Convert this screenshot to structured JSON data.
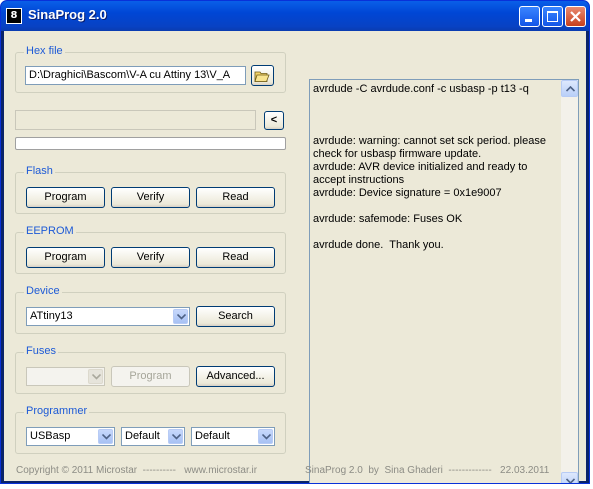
{
  "window": {
    "title": "SinaProg 2.0",
    "title_icon_glyph": "8"
  },
  "hex": {
    "legend": "Hex file",
    "path": "D:\\Draghici\\Bascom\\V-A cu Attiny 13\\V_A"
  },
  "flash": {
    "legend": "Flash",
    "program": "Program",
    "verify": "Verify",
    "read": "Read"
  },
  "eeprom": {
    "legend": "EEPROM",
    "program": "Program",
    "verify": "Verify",
    "read": "Read"
  },
  "device": {
    "legend": "Device",
    "selected": "ATtiny13",
    "search": "Search"
  },
  "fuses": {
    "legend": "Fuses",
    "selected": "",
    "program": "Program",
    "advanced": "Advanced..."
  },
  "programmer": {
    "legend": "Programmer",
    "type": "USBasp",
    "speed1": "Default",
    "speed2": "Default"
  },
  "collapse_button": "<",
  "output": {
    "text": "avrdude -C avrdude.conf -c usbasp -p t13 -q\n\n\n\navrdude: warning: cannot set sck period. please check for usbasp firmware update.\navrdude: AVR device initialized and ready to accept instructions\navrdude: Device signature = 0x1e9007\n\navrdude: safemode: Fuses OK\n\navrdude done.  Thank you."
  },
  "footer": {
    "left": "Copyright © 2011 Microstar  ----------   www.microstar.ir",
    "right": "SinaProg 2.0  by  Sina Ghaderi  -------------   22.03.2011"
  },
  "colors": {
    "title_bar": "#0046d5",
    "legend": "#1d5ad6",
    "face": "#ece9d8"
  }
}
